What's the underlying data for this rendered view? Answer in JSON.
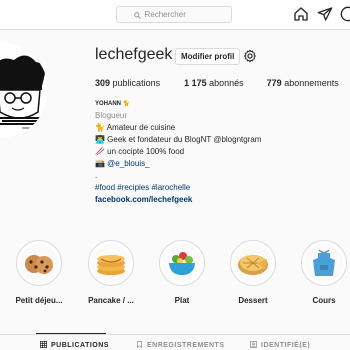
{
  "search": {
    "placeholder": "Rechercher"
  },
  "profile": {
    "username": "lechefgeek",
    "edit_label": "Modifier profil",
    "stats": {
      "publications_count": "309",
      "publications_label": "publications",
      "followers_count": "1 175",
      "followers_label": "abonnés",
      "following_count": "779",
      "following_label": "abonnements"
    },
    "bio": {
      "name": "YOHANN 🐈",
      "category": "Blogueur",
      "line1": "🐈 Amateur de cuisine",
      "line2": "👨‍💻 Geek et fondateur du BlogNT @blogntgram",
      "line3": "🥢 un cocipte 100% food",
      "line4": "📸 @e_blouis_",
      "line5": ".",
      "hashtags": "#food #recipies #larochelle",
      "website": "facebook.com/lechefgeek"
    }
  },
  "highlights": [
    {
      "label": "Petit déjeu..."
    },
    {
      "label": "Pancake / ..."
    },
    {
      "label": "Plat"
    },
    {
      "label": "Dessert"
    },
    {
      "label": "Cours"
    }
  ],
  "tabs": [
    {
      "label": "PUBLICATIONS",
      "active": true
    },
    {
      "label": "ENREGISTREMENTS",
      "active": false
    },
    {
      "label": "IDENTIFIÉ(E)",
      "active": false
    }
  ],
  "colors": {
    "link": "#00376b",
    "border": "#dbdbdb",
    "muted": "#8e8e8e"
  }
}
